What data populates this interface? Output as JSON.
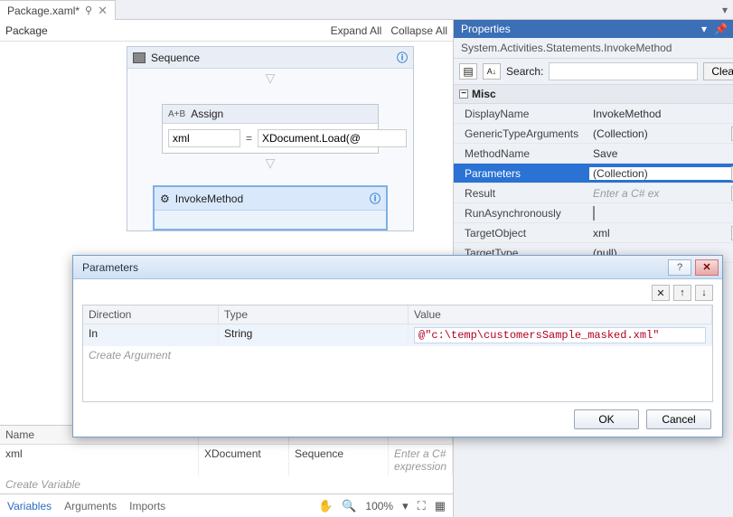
{
  "tab": {
    "title": "Package.xaml*",
    "close": "✕"
  },
  "breadcrumb": "Package",
  "expand_all": "Expand All",
  "collapse_all": "Collapse All",
  "sequence": {
    "label": "Sequence"
  },
  "assign": {
    "label": "Assign",
    "left": "xml",
    "right": "XDocument.Load(@"
  },
  "invoke": {
    "label": "InvokeMethod"
  },
  "vars": {
    "col_name": "Name",
    "col_type": "",
    "col_scope": "",
    "col_default": "",
    "row": {
      "name": "xml",
      "type": "XDocument",
      "scope": "Sequence",
      "default": "Enter a C# expression"
    },
    "create": "Create Variable"
  },
  "footer": {
    "variables": "Variables",
    "arguments": "Arguments",
    "imports": "Imports",
    "zoom": "100%"
  },
  "props": {
    "title": "Properties",
    "type": "System.Activities.Statements.InvokeMethod",
    "search_label": "Search:",
    "clear": "Clear",
    "category": "Misc",
    "rows": {
      "display": {
        "name": "DisplayName",
        "val": "InvokeMethod"
      },
      "generic": {
        "name": "GenericTypeArguments",
        "val": "(Collection)"
      },
      "method": {
        "name": "MethodName",
        "val": "Save"
      },
      "params": {
        "name": "Parameters",
        "val": "(Collection)"
      },
      "result": {
        "name": "Result",
        "val": "Enter a C# ex"
      },
      "runasync": {
        "name": "RunAsynchronously",
        "val": ""
      },
      "target": {
        "name": "TargetObject",
        "val": "xml"
      },
      "targettype": {
        "name": "TargetType",
        "val": "(null)"
      }
    }
  },
  "dialog": {
    "title": "Parameters",
    "col_dir": "Direction",
    "col_type": "Type",
    "col_val": "Value",
    "row": {
      "dir": "In",
      "type": "String",
      "val": "@\"c:\\temp\\customersSample_masked.xml\""
    },
    "create": "Create Argument",
    "ok": "OK",
    "cancel": "Cancel",
    "delete": "✕",
    "up": "↑",
    "down": "↓",
    "help": "?"
  }
}
